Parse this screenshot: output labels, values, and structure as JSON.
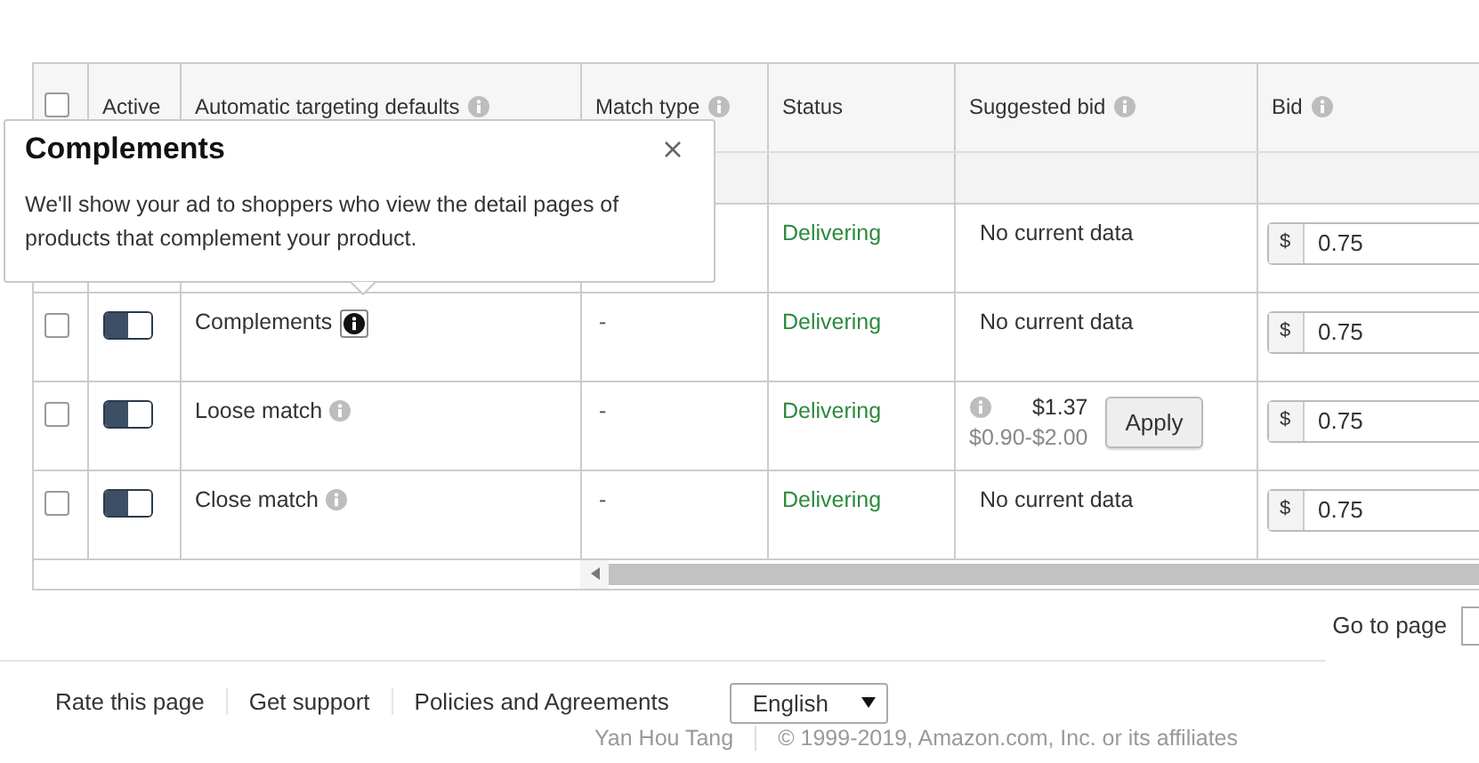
{
  "table": {
    "select_all": {
      "checked": false
    },
    "columns": [
      {
        "label": "Active",
        "info": false
      },
      {
        "label": "Automatic targeting defaults",
        "info": true
      },
      {
        "label": "Match type",
        "info": true
      },
      {
        "label": "Status",
        "info": false
      },
      {
        "label": "Suggested bid",
        "info": true
      },
      {
        "label": "Bid",
        "info": true
      }
    ],
    "rows": [
      {
        "status": "Delivering",
        "suggested": {
          "kind": "none",
          "text": "No current data"
        },
        "currency": "$",
        "bid": "0.75"
      },
      {
        "checked": false,
        "on": true,
        "name": "Complements",
        "info_focused": true,
        "match_type": "-",
        "status": "Delivering",
        "suggested": {
          "kind": "none",
          "text": "No current data"
        },
        "currency": "$",
        "bid": "0.75"
      },
      {
        "checked": false,
        "on": true,
        "name": "Loose match",
        "info_focused": false,
        "match_type": "-",
        "status": "Delivering",
        "suggested": {
          "kind": "range",
          "amount": "$1.37",
          "range": "$0.90-$2.00",
          "button": "Apply"
        },
        "currency": "$",
        "bid": "0.75"
      },
      {
        "checked": false,
        "on": true,
        "name": "Close match",
        "info_focused": false,
        "match_type": "-",
        "status": "Delivering",
        "suggested": {
          "kind": "none",
          "text": "No current data"
        },
        "currency": "$",
        "bid": "0.75"
      }
    ]
  },
  "tooltip": {
    "title": "Complements",
    "body": "We'll show your ad to shoppers who view the detail pages of products that complement your product."
  },
  "pagination": {
    "label": "Go to page"
  },
  "footer": {
    "links": [
      "Rate this page",
      "Get support",
      "Policies and Agreements"
    ],
    "language": "English",
    "credit": "Yan Hou Tang",
    "copyright": "© 1999-2019, Amazon.com, Inc. or its affiliates"
  }
}
